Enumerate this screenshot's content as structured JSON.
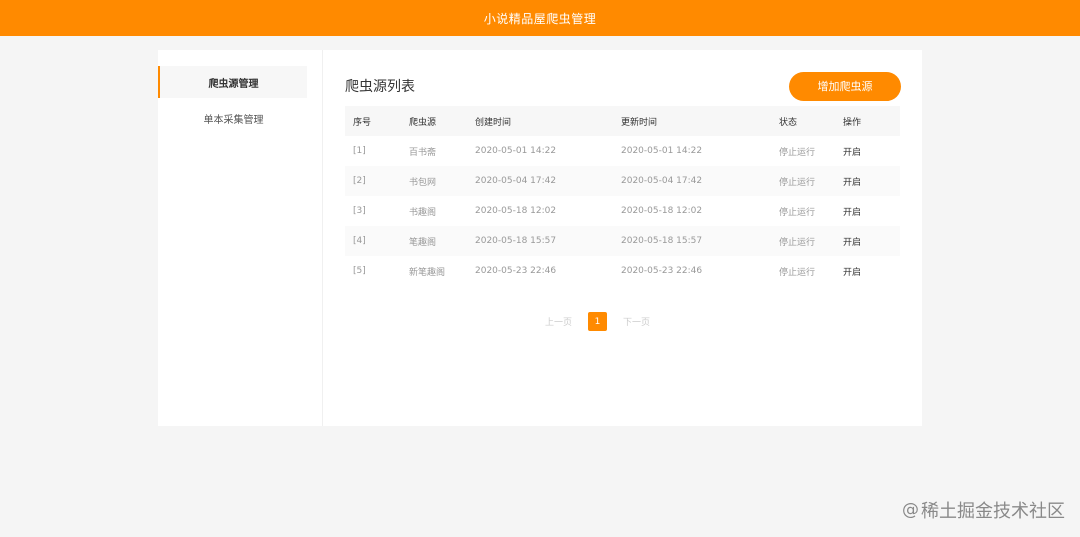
{
  "header": {
    "title": "小说精品屋爬虫管理"
  },
  "sidebar": {
    "items": [
      {
        "label": "爬虫源管理",
        "active": true
      },
      {
        "label": "单本采集管理",
        "active": false
      }
    ]
  },
  "main": {
    "title": "爬虫源列表",
    "add_button": "增加爬虫源"
  },
  "table": {
    "columns": [
      "序号",
      "爬虫源",
      "创建时间",
      "更新时间",
      "状态",
      "操作"
    ],
    "rows": [
      {
        "idx": "[1]",
        "source": "百书斋",
        "created": "2020-05-01 14:22",
        "updated": "2020-05-01 14:22",
        "status": "停止运行",
        "action": "开启"
      },
      {
        "idx": "[2]",
        "source": "书包网",
        "created": "2020-05-04 17:42",
        "updated": "2020-05-04 17:42",
        "status": "停止运行",
        "action": "开启"
      },
      {
        "idx": "[3]",
        "source": "书趣阁",
        "created": "2020-05-18 12:02",
        "updated": "2020-05-18 12:02",
        "status": "停止运行",
        "action": "开启"
      },
      {
        "idx": "[4]",
        "source": "笔趣阁",
        "created": "2020-05-18 15:57",
        "updated": "2020-05-18 15:57",
        "status": "停止运行",
        "action": "开启"
      },
      {
        "idx": "[5]",
        "source": "新笔趣阁",
        "created": "2020-05-23 22:46",
        "updated": "2020-05-23 22:46",
        "status": "停止运行",
        "action": "开启"
      }
    ]
  },
  "pagination": {
    "prev": "上一页",
    "current": "1",
    "next": "下一页"
  },
  "watermark": {
    "at": "@",
    "text": "稀土掘金技术社区"
  },
  "colors": {
    "accent": "#ff8a00",
    "background": "#f5f5f5"
  }
}
